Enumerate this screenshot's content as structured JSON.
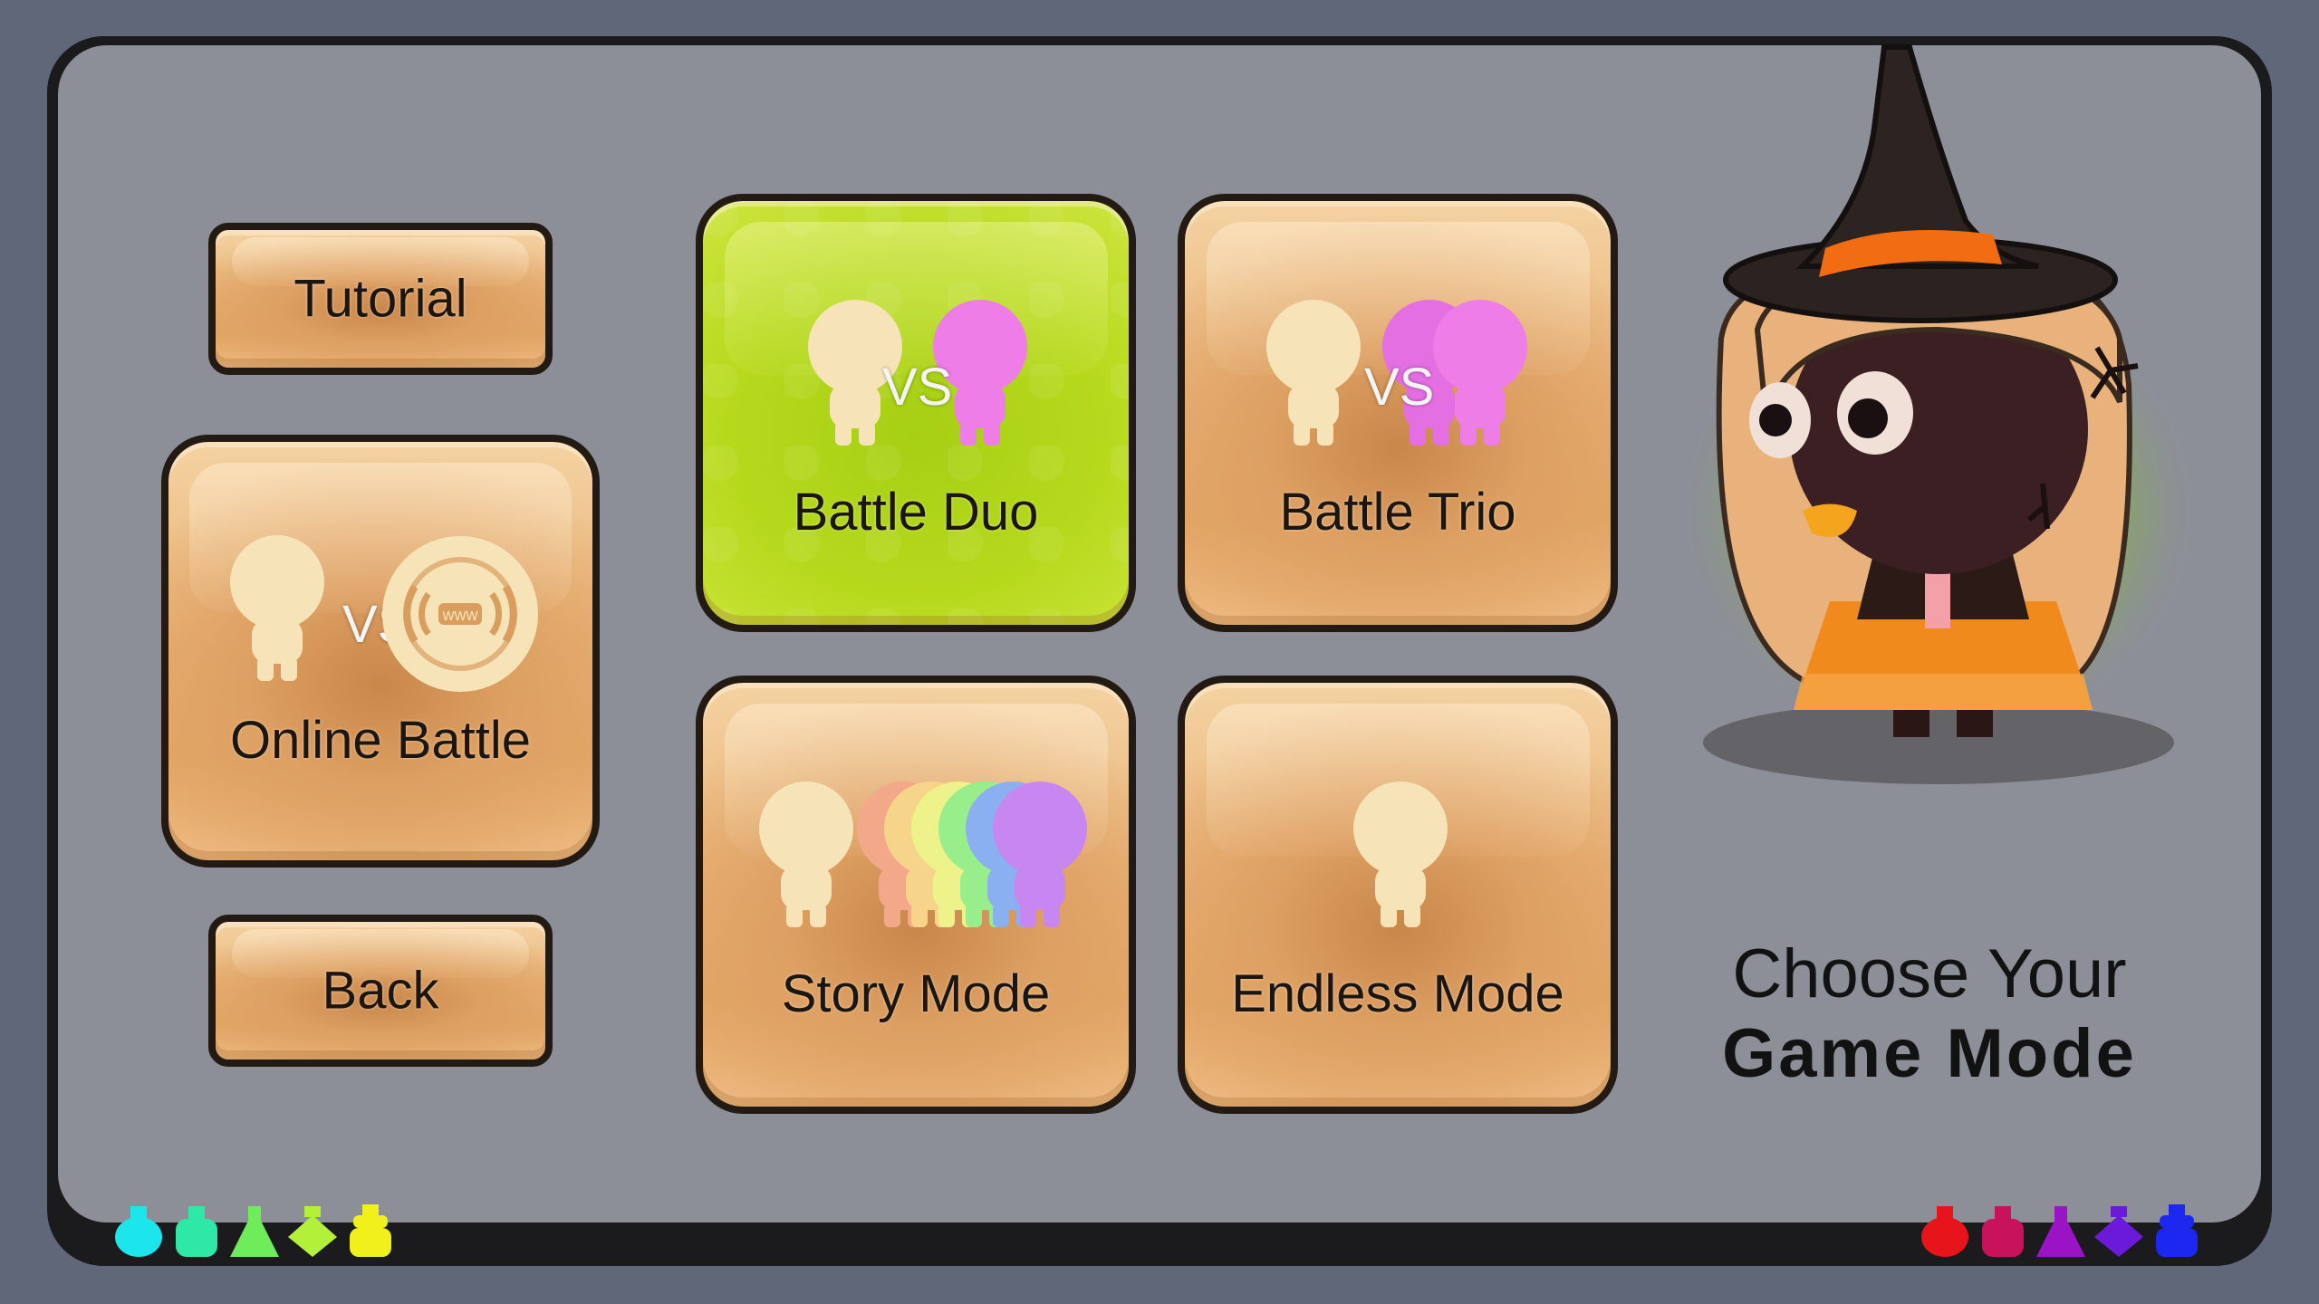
{
  "menu": {
    "tutorial_label": "Tutorial",
    "online_label": "Online Battle",
    "back_label": "Back",
    "battle_duo_label": "Battle Duo",
    "battle_trio_label": "Battle Trio",
    "story_label": "Story Mode",
    "endless_label": "Endless Mode",
    "vs_text": "VS",
    "www_text": "www"
  },
  "heading": {
    "line1": "Choose Your",
    "line2": "Game Mode"
  },
  "colors": {
    "button": "#e6ad6c",
    "selected": "#b3d61c",
    "player": "#f7e3b8",
    "rival": "#ee7de8",
    "panel": "#8c8f98"
  },
  "left_icons": [
    "potion-cyan",
    "potion-teal",
    "potion-green",
    "potion-lime",
    "potion-yellow"
  ],
  "right_icons": [
    "potion-red",
    "potion-crimson",
    "potion-purple",
    "potion-violet",
    "potion-blue"
  ],
  "selected_mode": "Battle Duo"
}
